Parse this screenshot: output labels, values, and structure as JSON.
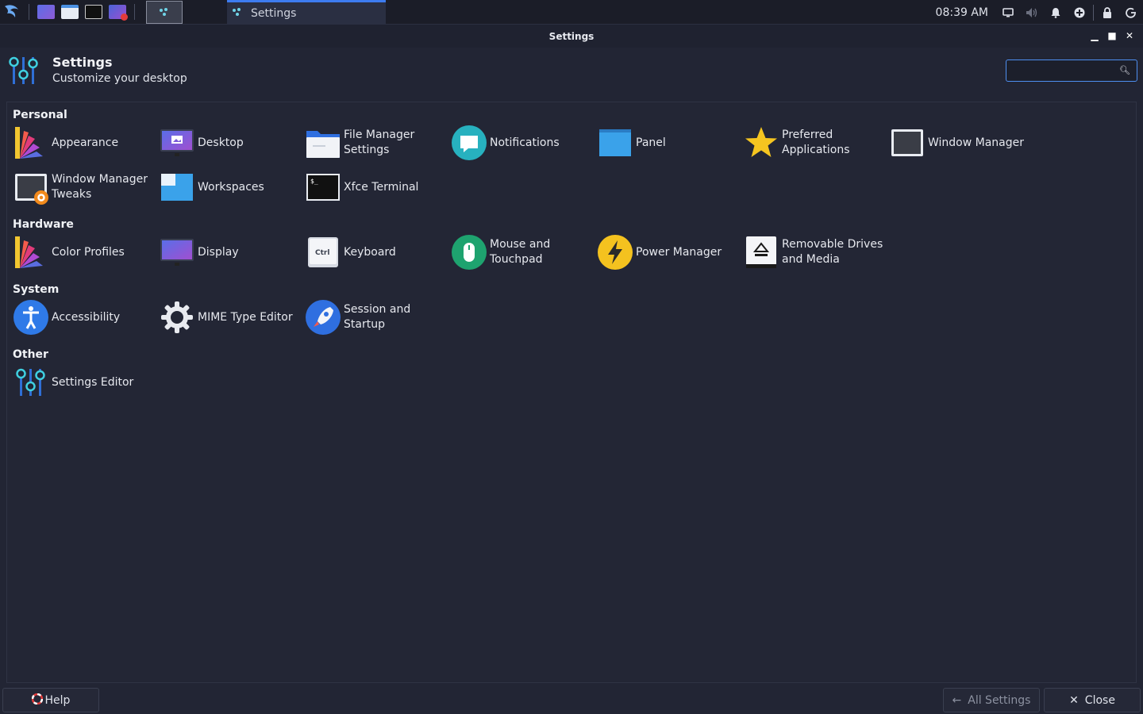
{
  "taskbar": {
    "launcher_icon": "kali-dragon-icon",
    "task_title": "Settings",
    "clock": "08:39 AM"
  },
  "window": {
    "title": "Settings",
    "minimize": "minimize-icon",
    "maximize": "maximize-icon",
    "close": "close-icon"
  },
  "header": {
    "title": "Settings",
    "subtitle": "Customize your desktop",
    "search_placeholder": ""
  },
  "sections": {
    "personal": "Personal",
    "hardware": "Hardware",
    "system": "System",
    "other": "Other"
  },
  "items": {
    "appearance": "Appearance",
    "desktop": "Desktop",
    "file_manager": "File Manager Settings",
    "notifications": "Notifications",
    "panel": "Panel",
    "preferred_apps": "Preferred Applications",
    "window_manager": "Window Manager",
    "wm_tweaks": "Window Manager Tweaks",
    "workspaces": "Workspaces",
    "terminal": "Xfce Terminal",
    "color_profiles": "Color Profiles",
    "display": "Display",
    "keyboard": "Keyboard",
    "mouse": "Mouse and Touchpad",
    "power": "Power Manager",
    "removable": "Removable Drives and Media",
    "accessibility": "Accessibility",
    "mime": "MIME Type Editor",
    "session": "Session and Startup",
    "settings_editor": "Settings Editor"
  },
  "footer": {
    "help": "Help",
    "all_settings": "All Settings",
    "close": "Close"
  },
  "colors": {
    "accent": "#3d7cf0",
    "background": "#222534",
    "panel": "#1b1d28"
  }
}
